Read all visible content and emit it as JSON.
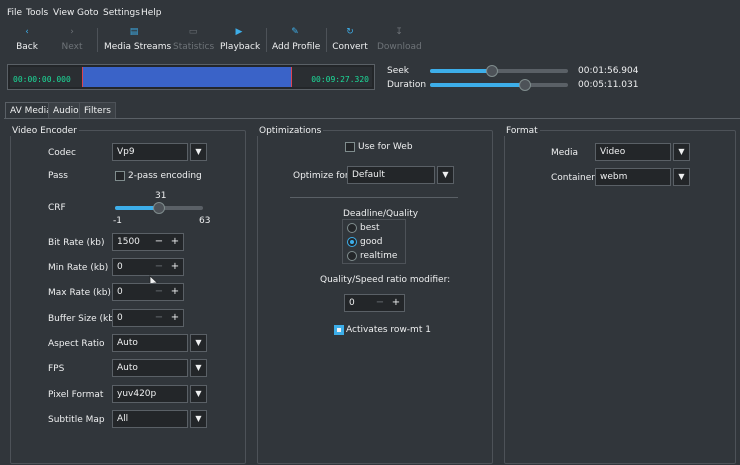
{
  "menu": [
    "File",
    "Tools",
    "View",
    "Goto",
    "Settings",
    "Help"
  ],
  "toolbar": {
    "back": "Back",
    "next": "Next",
    "media_streams": "Media Streams",
    "statistics": "Statistics",
    "playback": "Playback",
    "add_profile": "Add Profile",
    "convert": "Convert",
    "download": "Download"
  },
  "timeline": {
    "start": "00:00:00.000",
    "end": "00:09:27.320",
    "selection_start_fraction": 0.2,
    "selection_end_fraction": 0.78
  },
  "seek": {
    "label": "Seek",
    "value": "00:01:56.904",
    "fraction": 0.45
  },
  "duration": {
    "label": "Duration",
    "value": "00:05:11.031",
    "fraction": 0.69
  },
  "tabs": [
    "AV Media",
    "Audio",
    "Filters"
  ],
  "video_encoder": {
    "title": "Video Encoder",
    "codec": {
      "label": "Codec",
      "value": "Vp9"
    },
    "pass": {
      "label": "Pass",
      "checkbox": "2-pass encoding",
      "checked": false
    },
    "crf": {
      "label": "CRF",
      "value": "31",
      "min": "-1",
      "max": "63"
    },
    "bit_rate": {
      "label": "Bit Rate (kb)",
      "value": "1500"
    },
    "min_rate": {
      "label": "Min Rate (kb)",
      "value": "0"
    },
    "max_rate": {
      "label": "Max Rate (kb)",
      "value": "0"
    },
    "buffer_size": {
      "label": "Buffer Size (kb)",
      "value": "0"
    },
    "aspect_ratio": {
      "label": "Aspect Ratio",
      "value": "Auto"
    },
    "fps": {
      "label": "FPS",
      "value": "Auto"
    },
    "pixel_format": {
      "label": "Pixel Format",
      "value": "yuv420p"
    },
    "subtitle_map": {
      "label": "Subtitle Map",
      "value": "All"
    }
  },
  "optimizations": {
    "title": "Optimizations",
    "use_for_web": "Use for Web",
    "use_for_web_checked": false,
    "optimize_for": {
      "label": "Optimize for",
      "value": "Default"
    },
    "deadline": {
      "title": "Deadline/Quality",
      "options": [
        "best",
        "good",
        "realtime"
      ],
      "selected": "good"
    },
    "ratio": {
      "label": "Quality/Speed ratio modifier:",
      "value": "0"
    },
    "row_mt": {
      "label": "Activates row-mt 1",
      "checked": true
    }
  },
  "format": {
    "title": "Format",
    "media": {
      "label": "Media",
      "value": "Video"
    },
    "container": {
      "label": "Container",
      "value": "webm"
    }
  },
  "colors": {
    "accent": "#3daee9",
    "timeline_selection": "#3a63c8",
    "timecode": "#1cdc9a",
    "marker": "#da4453"
  }
}
